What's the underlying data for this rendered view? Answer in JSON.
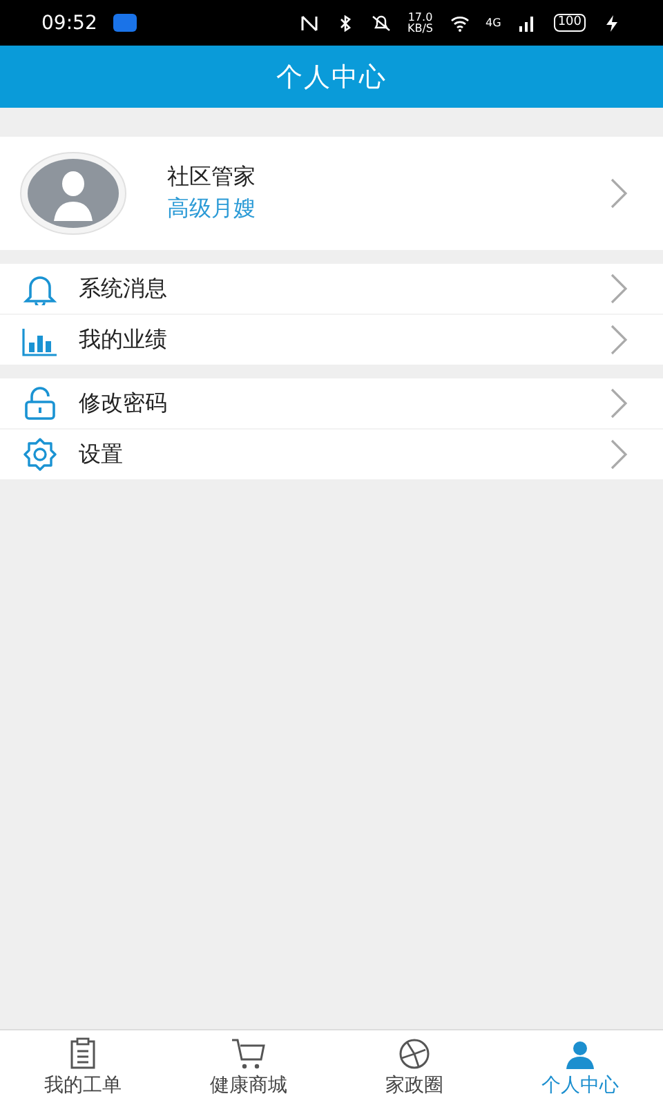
{
  "status_bar": {
    "time": "09:52",
    "speed": "17.0",
    "speed_unit": "KB/S",
    "network": "4G",
    "battery": "100"
  },
  "header": {
    "title": "个人中心"
  },
  "profile": {
    "name": "社区管家",
    "role": "高级月嫂"
  },
  "menu_groups": [
    {
      "items": [
        {
          "label": "系统消息"
        },
        {
          "label": "我的业绩"
        }
      ]
    },
    {
      "items": [
        {
          "label": "修改密码"
        },
        {
          "label": "设置"
        }
      ]
    }
  ],
  "tabs": [
    {
      "label": "我的工单",
      "selected": false
    },
    {
      "label": "健康商城",
      "selected": false
    },
    {
      "label": "家政圈",
      "selected": false
    },
    {
      "label": "个人中心",
      "selected": true
    }
  ]
}
